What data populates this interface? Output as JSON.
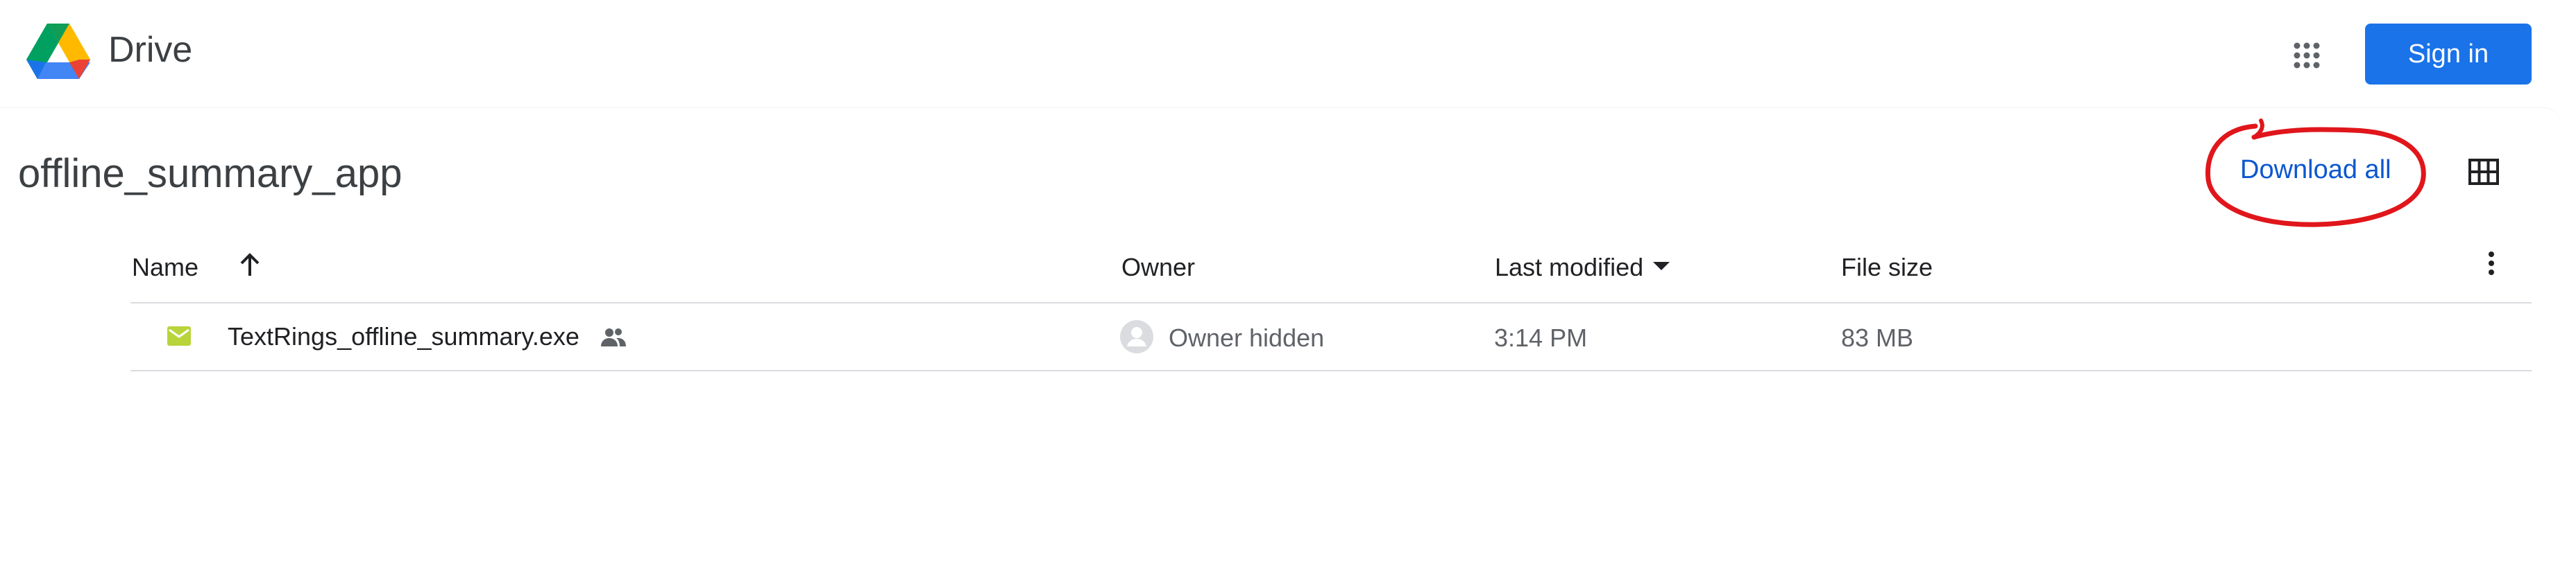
{
  "header": {
    "app_name": "Drive",
    "sign_in_label": "Sign in",
    "apps_icon": "apps-grid-icon",
    "logo_icon": "google-drive-logo"
  },
  "folder": {
    "title": "offline_summary_app",
    "download_all_label": "Download all",
    "view_toggle_icon": "grid-view-icon"
  },
  "table": {
    "columns": {
      "name": "Name",
      "owner": "Owner",
      "last_modified": "Last modified",
      "file_size": "File size"
    },
    "rows": [
      {
        "name": "TextRings_offline_summary.exe",
        "owner": "Owner hidden",
        "last_modified": "3:14 PM",
        "file_size": "83 MB",
        "icon": "file-icon",
        "shared_icon": "people-icon"
      }
    ]
  },
  "colors": {
    "primary_blue": "#1a73e8",
    "link_blue": "#0b57d0",
    "annotation_red": "#e0161b",
    "file_icon_green": "#b8d43a"
  }
}
